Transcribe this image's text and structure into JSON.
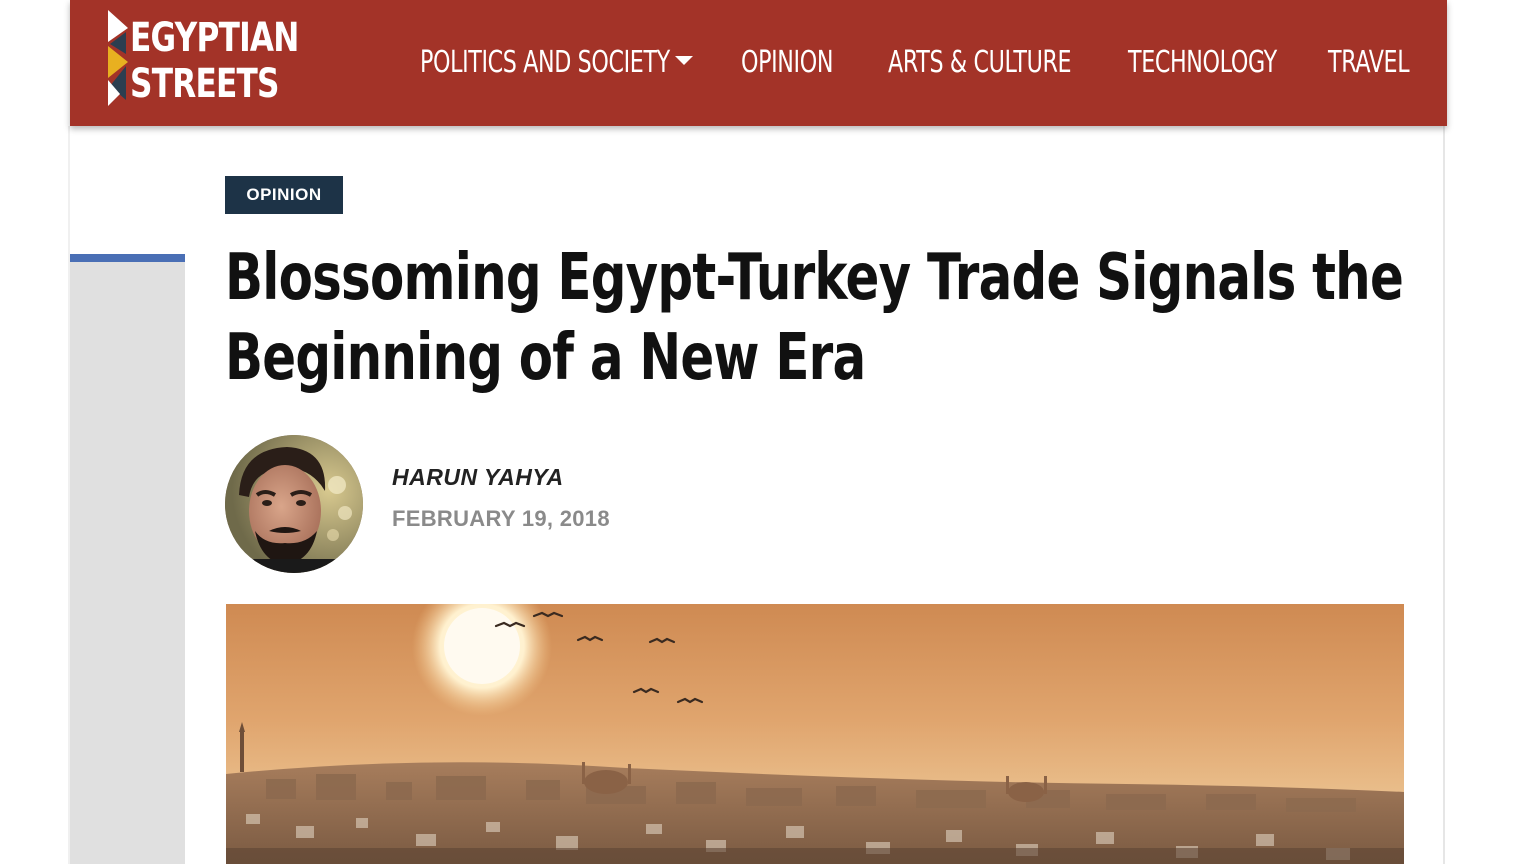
{
  "site": {
    "logo_line1": "EGYPTIAN",
    "logo_line2": "STREETS",
    "brand_color": "#a33328"
  },
  "nav": {
    "items": [
      {
        "label": "POLITICS AND SOCIETY",
        "has_dropdown": true
      },
      {
        "label": "OPINION"
      },
      {
        "label": "ARTS & CULTURE"
      },
      {
        "label": "TECHNOLOGY"
      },
      {
        "label": "TRAVEL"
      }
    ]
  },
  "article": {
    "category": "OPINION",
    "title_line1": "Blossoming Egypt-Turkey Trade Signals the",
    "title_line2": "Beginning of a New Era",
    "author": "HARUN YAHYA",
    "date": "FEBRUARY 19, 2018"
  },
  "icons": {
    "logo_mark": "chevron-flag-icon",
    "dropdown": "caret-down-icon"
  },
  "colors": {
    "header_bg": "#a33328",
    "badge_bg": "#1d3347",
    "rail_accent": "#4a6fb5"
  }
}
